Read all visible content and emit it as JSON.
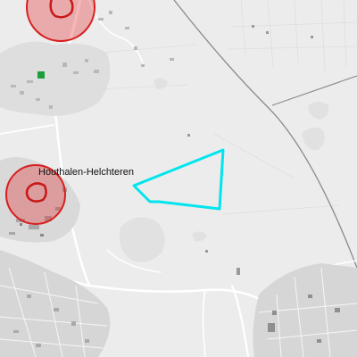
{
  "places": [
    {
      "id": "houthalen-helchteren",
      "label": "Houthalen-Helchteren"
    }
  ],
  "markers": [
    {
      "id": "north-marker",
      "kind": "risk-circle",
      "color": "#e02424"
    },
    {
      "id": "houthalen-marker",
      "kind": "risk-circle",
      "color": "#e02424"
    },
    {
      "id": "green-square",
      "kind": "point",
      "color": "#1e9e3a"
    }
  ],
  "selection": {
    "kind": "polygon",
    "color": "#00e5ee"
  },
  "colors": {
    "background": "#ececec",
    "roads": "#ffffff",
    "rail": "#7a7a7a",
    "urban": "#cfcfcf",
    "buildings": "#a9a9a9",
    "water": "#dcdcdc"
  }
}
